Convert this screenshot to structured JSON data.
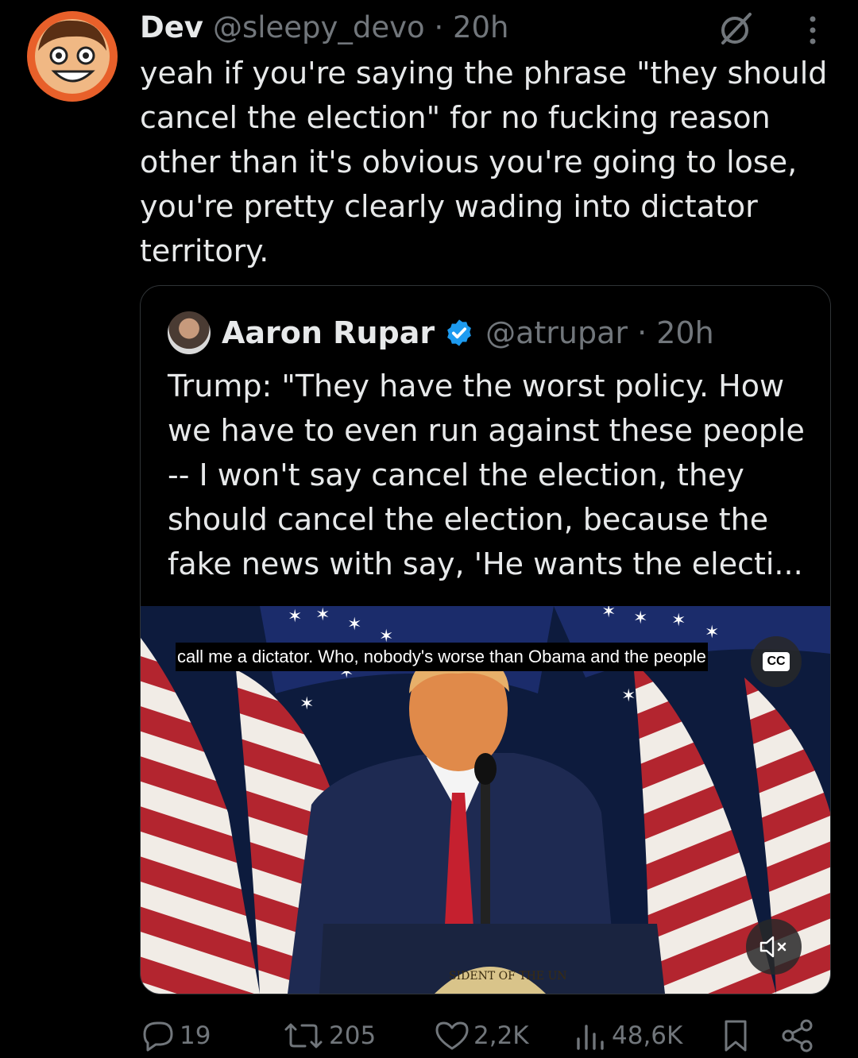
{
  "tweet": {
    "author_name": "Dev",
    "handle_time": "@sleepy_devo · 20h",
    "text": "yeah if you're saying the phrase \"they should cancel the election\" for no fucking reason other than it's obvious you're going to lose, you're pretty clearly wading into dictator territory."
  },
  "quote": {
    "author_name": "Aaron Rupar",
    "handle_time": "@atrupar · 20h",
    "text": "Trump: \"They have the worst policy. How we have to even run against these people -- I won't say cancel the election, they should cancel the election, because the fake news with say, 'He wants the electi...",
    "video": {
      "caption": "call me a dictator. Who, nobody's worse than Obama and the people",
      "cc_label": "CC",
      "podium_seal_text": "SIDENT OF THE UN"
    }
  },
  "actions": {
    "replies": "19",
    "reposts": "205",
    "likes": "2,2K",
    "views": "48,6K"
  },
  "colors": {
    "background": "#000000",
    "text": "#e7e9ea",
    "muted": "#71767b",
    "border": "#2f3336",
    "verified": "#1d9bf0"
  },
  "icons": [
    "grok-icon",
    "more-vertical-icon",
    "verified-badge-icon",
    "cc-icon",
    "mute-icon",
    "reply-icon",
    "repost-icon",
    "like-icon",
    "views-icon",
    "bookmark-icon",
    "share-icon"
  ]
}
